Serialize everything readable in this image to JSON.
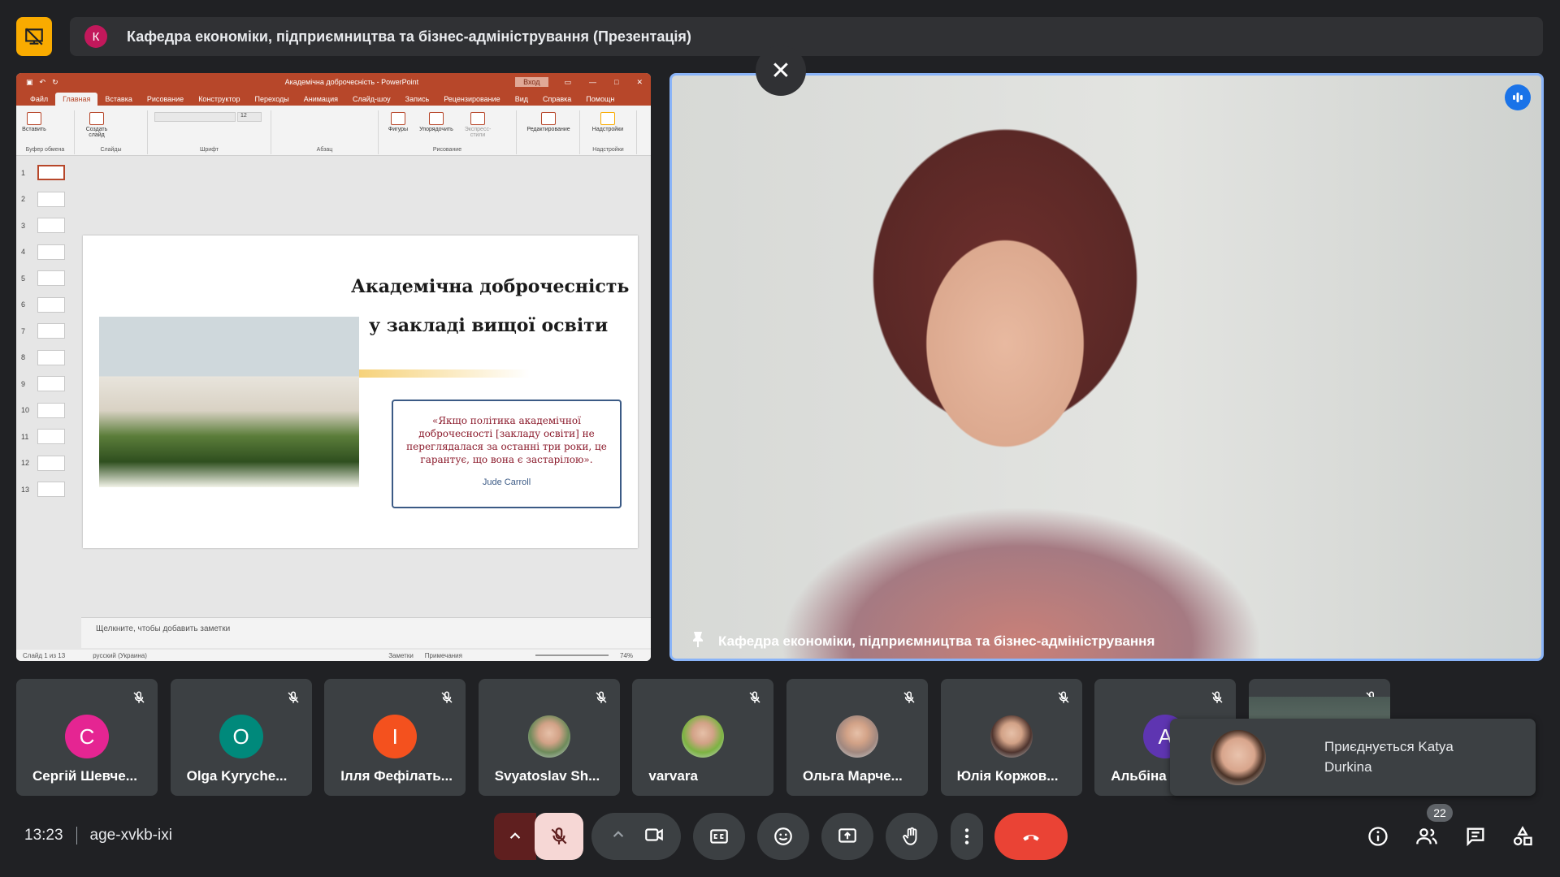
{
  "top_bar": {
    "presenter_initial": "К",
    "title": "Кафедра економіки, підприємництва та бізнес-адміністрування (Презентація)"
  },
  "ppt": {
    "window_title": "Академічна доброчесність  -  PowerPoint",
    "signin": "Вход",
    "tabs": [
      "Файл",
      "Главная",
      "Вставка",
      "Рисование",
      "Конструктор",
      "Переходы",
      "Анимация",
      "Слайд-шоу",
      "Запись",
      "Рецензирование",
      "Вид",
      "Справка",
      "Помощн"
    ],
    "ribbon": {
      "paste": "Вставить",
      "clipboard": "Буфер обмена",
      "new_slide": "Создать слайд",
      "slides": "Слайды",
      "font": "Шрифт",
      "font_size": "12",
      "paragraph": "Абзац",
      "shapes": "Фигуры",
      "arrange": "Упорядочить",
      "quick_styles": "Экспресс-стили",
      "drawing": "Рисование",
      "editing": "Редактирование",
      "addins": "Надстройки",
      "addins_group": "Надстройки"
    },
    "thumb_numbers": [
      "1",
      "2",
      "3",
      "4",
      "5",
      "6",
      "7",
      "8",
      "9",
      "10",
      "11",
      "12",
      "13"
    ],
    "slide": {
      "title_line1": "Академічна доброчесність",
      "title_line2": "у закладі вищої освіти",
      "quote": "«Якщо політика академічної доброчесності [закладу освіти] не переглядалася за останні три роки, це гарантує, що вона є застарілою».",
      "quote_author": "Jude Carroll"
    },
    "notes_placeholder": "Щелкните, чтобы добавить заметки",
    "status": {
      "slide_count": "Слайд 1 из 13",
      "language": "русский (Украина)",
      "notes": "Заметки",
      "comments": "Примечания",
      "zoom": "74%"
    }
  },
  "speaker": {
    "name": "Кафедра економіки, підприємництва та бізнес-адміністрування"
  },
  "participants": [
    {
      "name": "Сергій Шевче...",
      "initial": "С",
      "color": "#e52592",
      "photo": false
    },
    {
      "name": "Olga Kyryche...",
      "initial": "O",
      "color": "#00897b",
      "photo": false
    },
    {
      "name": "Ілля Фефілать...",
      "initial": "І",
      "color": "#f4511e",
      "photo": false
    },
    {
      "name": "Svyatoslav Sh...",
      "initial": "",
      "color": "#6d8a5a",
      "photo": true
    },
    {
      "name": "varvara",
      "initial": "",
      "color": "#7cb342",
      "photo": true
    },
    {
      "name": "Ольга Марче...",
      "initial": "",
      "color": "#a1887f",
      "photo": true
    },
    {
      "name": "Юлія Коржов...",
      "initial": "",
      "color": "#4e342e",
      "photo": true
    },
    {
      "name": "Альбіна",
      "initial": "А",
      "color": "#5e35b1",
      "photo": false
    }
  ],
  "toast": {
    "text": "Приєднується Katya Durkina"
  },
  "bottom": {
    "time": "13:23",
    "meeting_code": "age-xvkb-ixi",
    "people_count": "22"
  },
  "colors": {
    "background": "#202124",
    "tile": "#3c4043",
    "end_call": "#ea4335",
    "speaking_border": "#8ab4f8",
    "ppt_red": "#b7472a"
  }
}
